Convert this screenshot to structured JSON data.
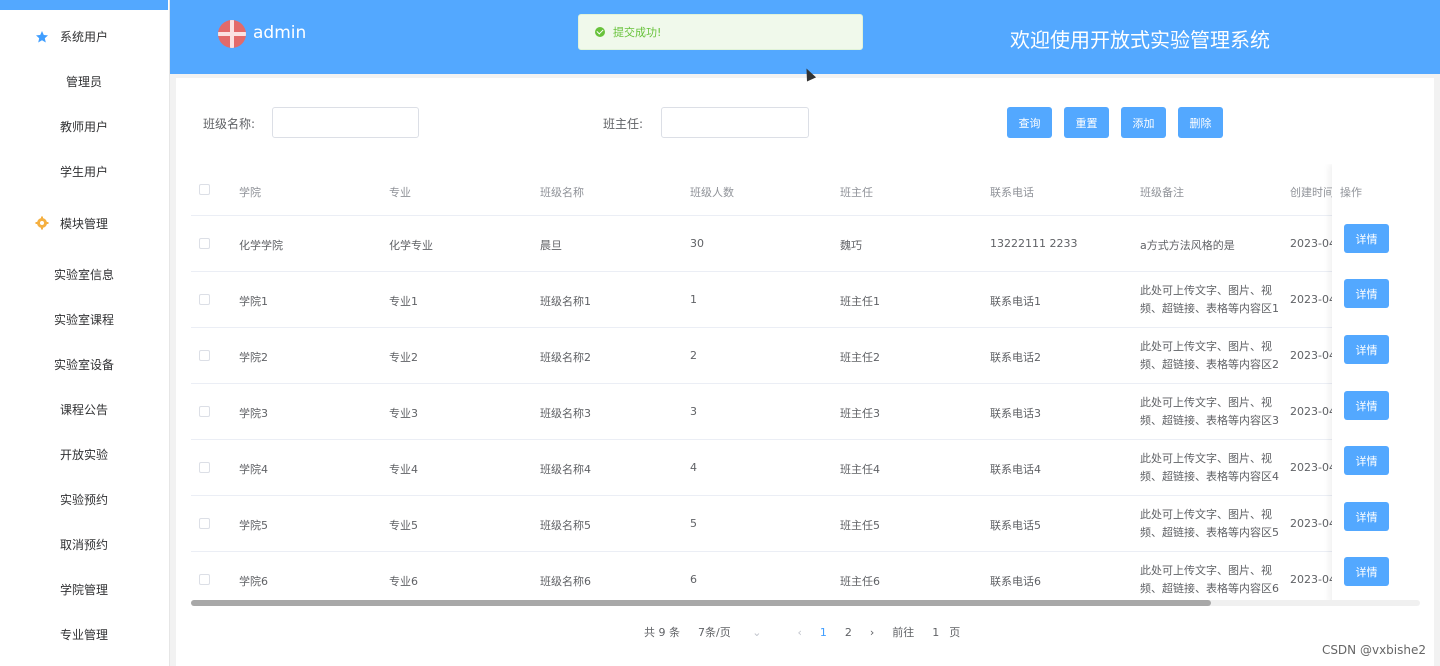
{
  "sidebar": {
    "groups": [
      {
        "label": "系统用户",
        "icon": "star-icon",
        "items": [
          "管理员",
          "教师用户",
          "学生用户"
        ]
      },
      {
        "label": "模块管理",
        "icon": "gear-icon",
        "items": [
          "实验室信息",
          "实验室课程",
          "实验室设备",
          "课程公告",
          "开放实验",
          "实验预约",
          "取消预约",
          "学院管理",
          "专业管理"
        ]
      }
    ]
  },
  "header": {
    "username": "admin",
    "title": "欢迎使用开放式实验管理系统"
  },
  "toast": {
    "message": "提交成功!"
  },
  "search": {
    "class_label": "班级名称:",
    "class_value": "",
    "teacher_label": "班主任:",
    "teacher_value": "",
    "buttons": {
      "query": "查询",
      "reset": "重置",
      "add": "添加",
      "delete": "删除"
    }
  },
  "table": {
    "columns": [
      "学院",
      "专业",
      "班级名称",
      "班级人数",
      "班主任",
      "联系电话",
      "班级备注",
      "创建时间",
      "操作"
    ],
    "rows": [
      {
        "college": "化学学院",
        "major": "化学专业",
        "class_name": "晨旦",
        "count": "30",
        "teacher": "魏巧",
        "phone": "13222111 2233",
        "remark": "a方式方法风格的是",
        "created": "2023-04",
        "action": "详情"
      },
      {
        "college": "学院1",
        "major": "专业1",
        "class_name": "班级名称1",
        "count": "1",
        "teacher": "班主任1",
        "phone": "联系电话1",
        "remark": "此处可上传文字、图片、视频、超链接、表格等内容区1",
        "created": "2023-04",
        "action": "详情"
      },
      {
        "college": "学院2",
        "major": "专业2",
        "class_name": "班级名称2",
        "count": "2",
        "teacher": "班主任2",
        "phone": "联系电话2",
        "remark": "此处可上传文字、图片、视频、超链接、表格等内容区2",
        "created": "2023-04",
        "action": "详情"
      },
      {
        "college": "学院3",
        "major": "专业3",
        "class_name": "班级名称3",
        "count": "3",
        "teacher": "班主任3",
        "phone": "联系电话3",
        "remark": "此处可上传文字、图片、视频、超链接、表格等内容区3",
        "created": "2023-04",
        "action": "详情"
      },
      {
        "college": "学院4",
        "major": "专业4",
        "class_name": "班级名称4",
        "count": "4",
        "teacher": "班主任4",
        "phone": "联系电话4",
        "remark": "此处可上传文字、图片、视频、超链接、表格等内容区4",
        "created": "2023-04",
        "action": "详情"
      },
      {
        "college": "学院5",
        "major": "专业5",
        "class_name": "班级名称5",
        "count": "5",
        "teacher": "班主任5",
        "phone": "联系电话5",
        "remark": "此处可上传文字、图片、视频、超链接、表格等内容区5",
        "created": "2023-04",
        "action": "详情"
      },
      {
        "college": "学院6",
        "major": "专业6",
        "class_name": "班级名称6",
        "count": "6",
        "teacher": "班主任6",
        "phone": "联系电话6",
        "remark": "此处可上传文字、图片、视频、超链接、表格等内容区6",
        "created": "2023-04",
        "action": "详情"
      }
    ]
  },
  "pagination": {
    "total": "共 9 条",
    "page_size": "7条/页",
    "pages": [
      "1",
      "2"
    ],
    "current": "1",
    "goto_label": "前往",
    "goto_value": "1",
    "goto_suffix": "页"
  },
  "watermark": "CSDN @vxbishe2",
  "colors": {
    "primary": "#53a8ff",
    "success": "#67c23a",
    "toast_bg": "#f0f9eb"
  }
}
